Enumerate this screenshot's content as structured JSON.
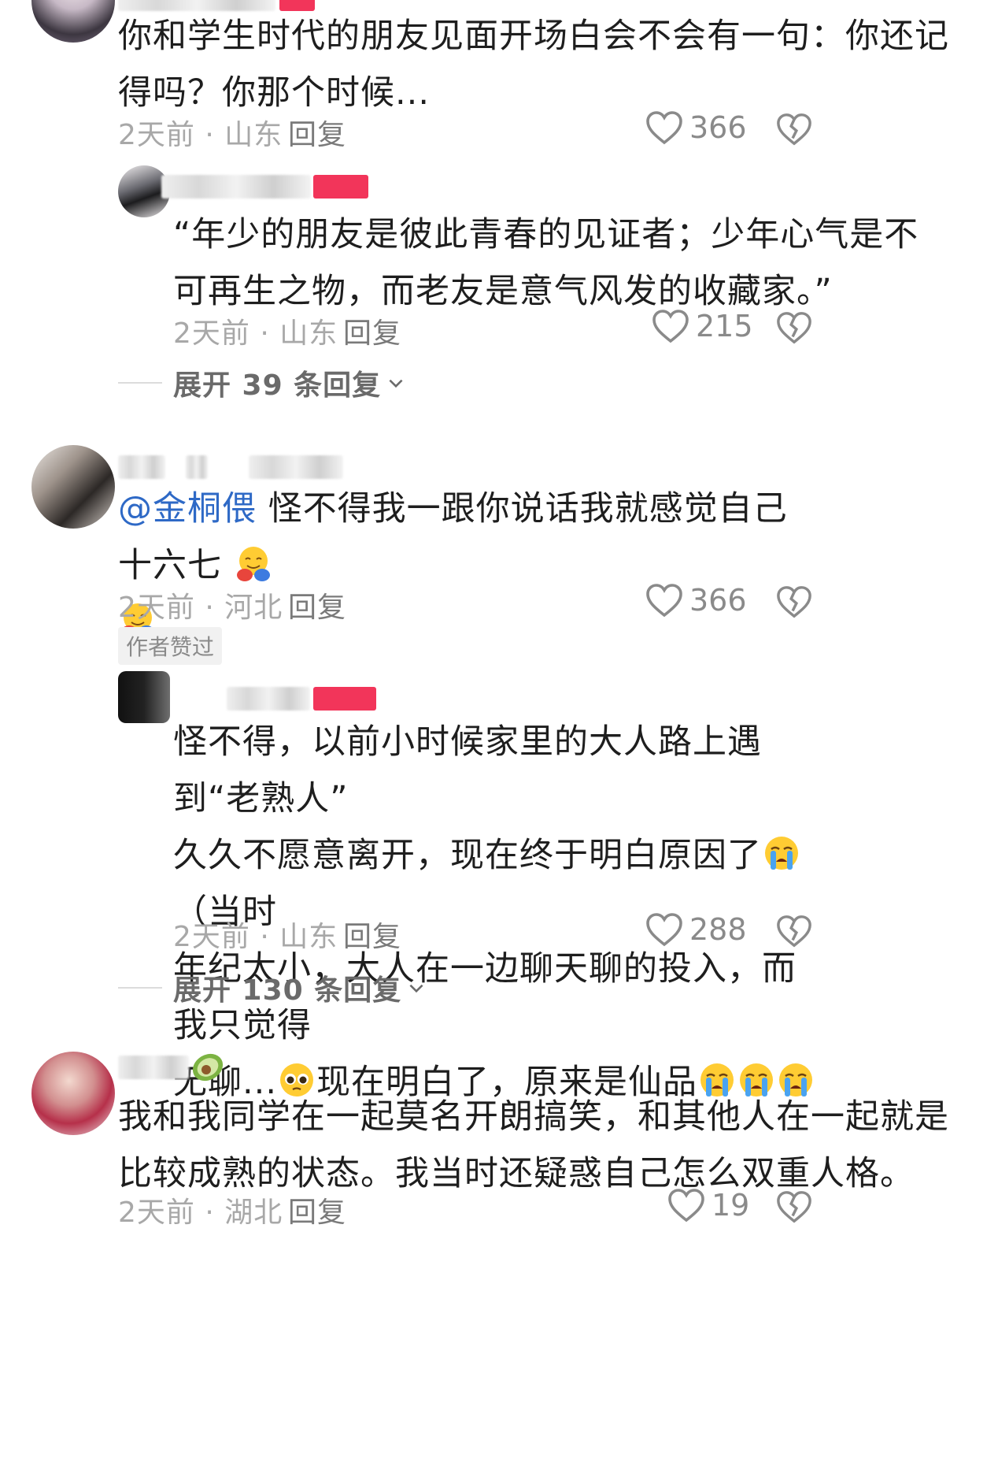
{
  "comments": [
    {
      "text": "你和学生时代的朋友见面开场白会不会有一句：你还记得吗？你那个时候...",
      "text_line1": "你和学生时代的朋友见面开场白会不会有一句：你还记",
      "text_line2": "得吗？你那个时候...",
      "meta": "2天前 · 山东",
      "reply_label": "回复",
      "likes": "366",
      "replies": [
        {
          "text_line1": "“年少的朋友是彼此青春的见证者；少年心气是不",
          "text_line2": "可再生之物，而老友是意气风发的收藏家。”",
          "meta": "2天前 · 山东",
          "reply_label": "回复",
          "likes": "215"
        }
      ],
      "expand_label": "展开 39 条回复"
    },
    {
      "mention": "@金桐偎",
      "text_line1": "怪不得我一跟你说话我就感觉自己十六七",
      "meta": "2天前 · 河北",
      "reply_label": "回复",
      "likes": "366",
      "author_badge": "作者赞过",
      "replies": [
        {
          "text_line1": "怪不得，以前小时候家里的大人路上遇到“老熟人”",
          "text_line2a": "久久不愿意离开，现在终于明白原因了",
          "text_line2b": "（当时",
          "text_line3": "年纪太小，大人在一边聊天聊的投入，而我只觉得",
          "text_line4a": "无聊...",
          "text_line4b": "现在明白了，原来是仙品",
          "meta": "2天前 · 山东",
          "reply_label": "回复",
          "likes": "288"
        }
      ],
      "expand_label": "展开 130 条回复"
    },
    {
      "text_line1": "我和我同学在一起莫名开朗搞笑，和其他人在一起就是",
      "text_line2": "比较成熟的状态。我当时还疑惑自己怎么双重人格。",
      "meta": "2天前 · 湖北",
      "reply_label": "回复",
      "likes": "19"
    }
  ],
  "icons": {
    "like": "heart-outline-icon",
    "dislike": "broken-heart-icon",
    "expand": "chevron-down-icon",
    "emoji_hug": "hugging-face-emoji",
    "emoji_cry": "loudly-crying-face-emoji",
    "emoji_plead": "pleading-face-emoji"
  },
  "colors": {
    "mention": "#2e69c6",
    "meta": "#a8a8a8",
    "brand_pink": "#f2355a"
  }
}
